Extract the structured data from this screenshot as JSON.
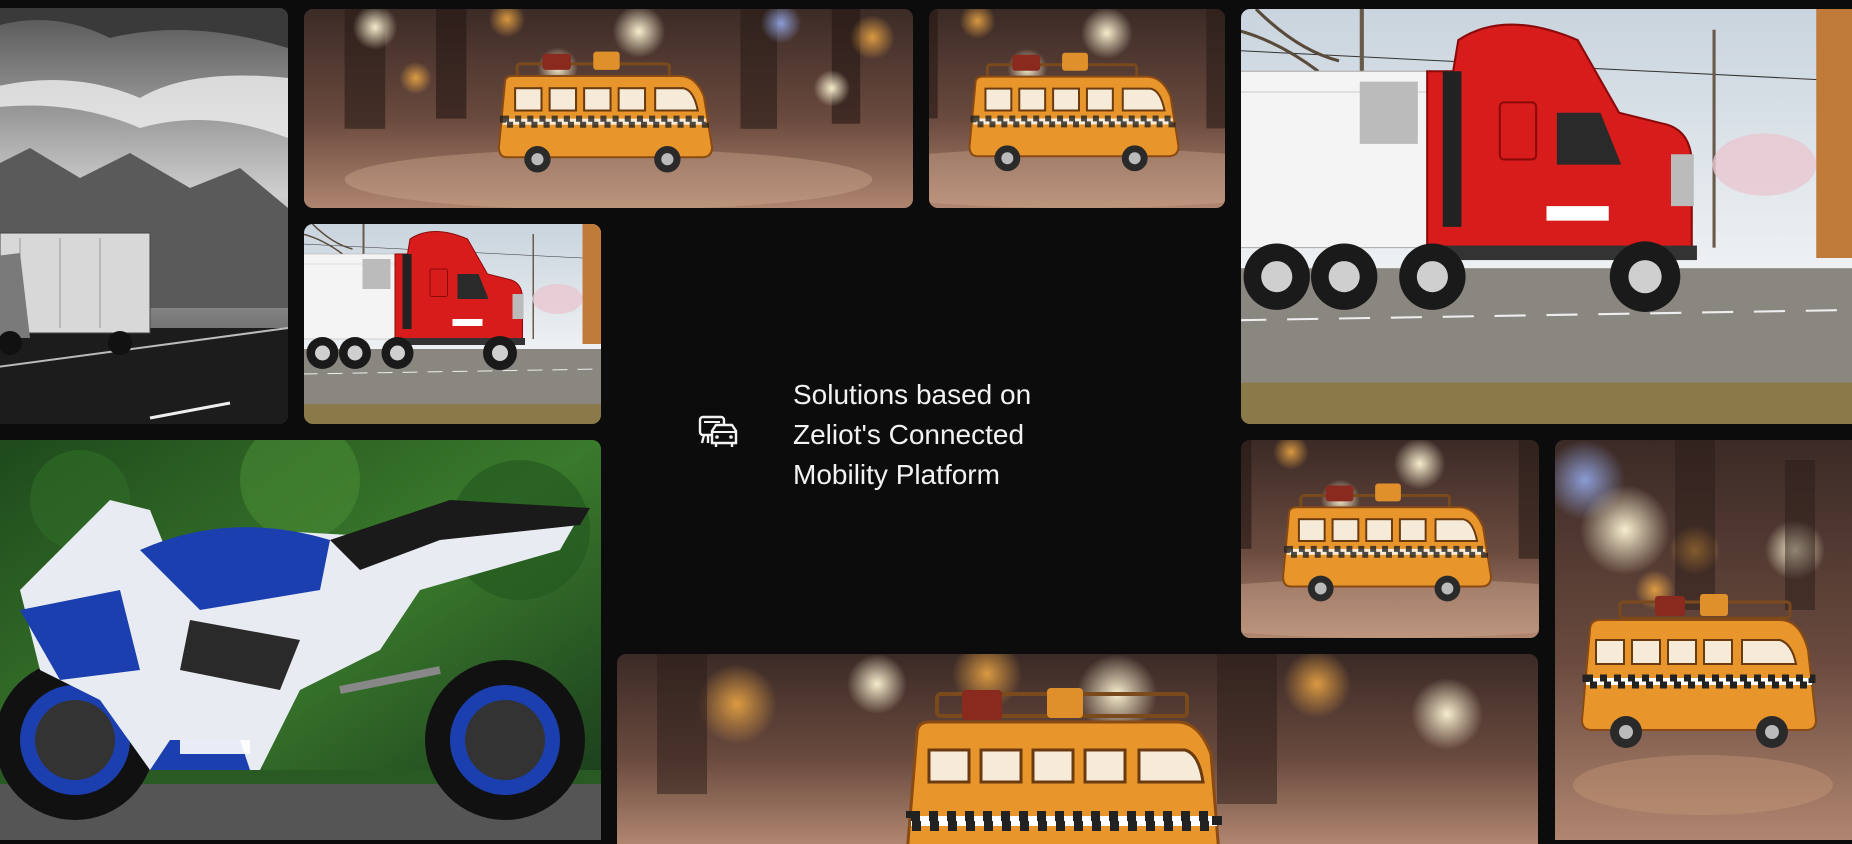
{
  "headline": {
    "line1": "Solutions based on",
    "line2": "Zeliot's Connected",
    "line3": "Mobility Platform"
  },
  "icons": {
    "feature": "vehicles-icon"
  },
  "images": [
    {
      "name": "highway-truck-bw-image",
      "subject": "Black and white truck on highway under mountains"
    },
    {
      "name": "toy-bus-bokeh-image-1",
      "subject": "Orange toy van on reflective street with bokeh lights"
    },
    {
      "name": "toy-bus-bokeh-image-2",
      "subject": "Orange toy van on reflective street with bokeh lights"
    },
    {
      "name": "red-semi-truck-large-image",
      "subject": "Red semi truck with white trailer"
    },
    {
      "name": "red-semi-truck-small-image",
      "subject": "Red semi truck with white trailer"
    },
    {
      "name": "suzuki-motorcycle-image",
      "subject": "Blue and white Suzuki sport motorcycle"
    },
    {
      "name": "toy-bus-bokeh-image-3",
      "subject": "Orange toy van on reflective street with bokeh lights"
    },
    {
      "name": "toy-bus-bokeh-image-4",
      "subject": "Orange toy van close-up with bokeh lights"
    },
    {
      "name": "toy-bus-bokeh-image-5",
      "subject": "Orange toy van close-up with bokeh lights"
    }
  ],
  "colors": {
    "background": "#0c0c0c",
    "text": "#f2f2f2",
    "toy_bus": "#e8962c",
    "truck_red": "#d81c1c",
    "motorcycle_blue": "#1c3fb0"
  }
}
